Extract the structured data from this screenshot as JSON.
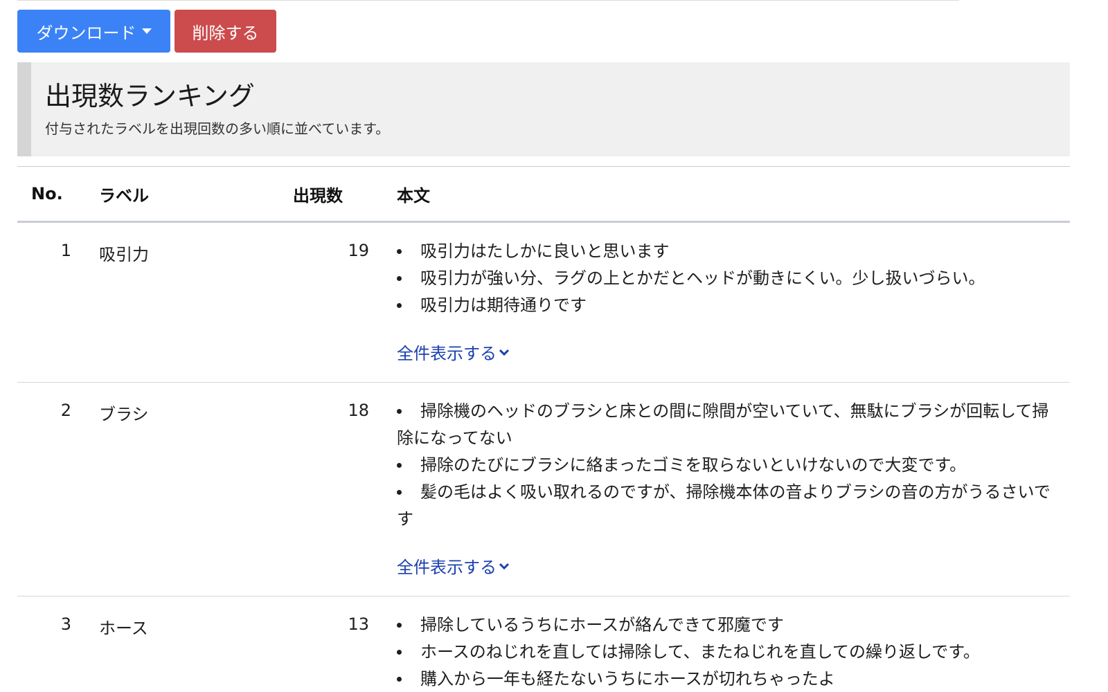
{
  "toolbar": {
    "download_label": "ダウンロード",
    "delete_label": "削除する"
  },
  "section": {
    "title": "出現数ランキング",
    "description": "付与されたラベルを出現回数の多い順に並べています。"
  },
  "table": {
    "headers": {
      "no": "No.",
      "label": "ラベル",
      "count": "出現数",
      "text": "本文"
    },
    "show_all_label": "全件表示する",
    "rows": [
      {
        "no": "1",
        "label": "吸引力",
        "count": "19",
        "snippets": [
          "吸引力はたしかに良いと思います",
          "吸引力が強い分、ラグの上とかだとヘッドが動きにくい。少し扱いづらい。",
          "吸引力は期待通りです"
        ]
      },
      {
        "no": "2",
        "label": "ブラシ",
        "count": "18",
        "snippets": [
          "掃除機のヘッドのブラシと床との間に隙間が空いていて、無駄にブラシが回転して掃除になってない",
          "掃除のたびにブラシに絡まったゴミを取らないといけないので大変です。",
          "髪の毛はよく吸い取れるのですが、掃除機本体の音よりブラシの音の方がうるさいです"
        ]
      },
      {
        "no": "3",
        "label": "ホース",
        "count": "13",
        "snippets": [
          "掃除しているうちにホースが絡んできて邪魔です",
          "ホースのねじれを直しては掃除して、またねじれを直しての繰り返しです。",
          "購入から一年も経たないうちにホースが切れちゃったよ"
        ]
      }
    ]
  },
  "colors": {
    "primary": "#3b82f6",
    "danger": "#cc4b4c",
    "link": "#1a3fb0",
    "section_bg": "#f0f0f0"
  }
}
